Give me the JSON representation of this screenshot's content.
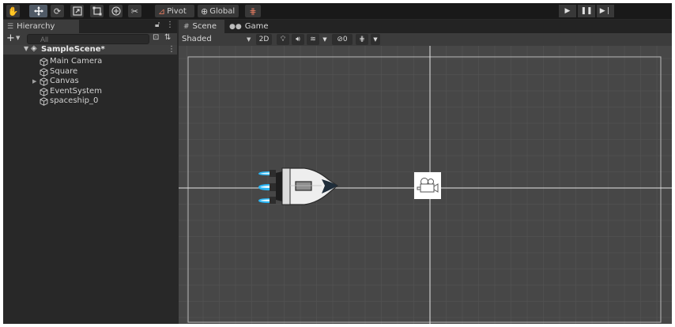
{
  "toolbar": {
    "tools": [
      "hand-tool",
      "move-tool",
      "rotate-tool",
      "scale-tool",
      "rect-tool",
      "transform-tool",
      "custom-tool"
    ],
    "pivot_label": "Pivot",
    "global_label": "Global",
    "playback": [
      "play",
      "pause",
      "step"
    ]
  },
  "hierarchy": {
    "tab_label": "Hierarchy",
    "add_label": "+",
    "search_placeholder": "All",
    "scene_name": "SampleScene*",
    "items": [
      {
        "label": "Main Camera",
        "has_children": false
      },
      {
        "label": "Square",
        "has_children": false
      },
      {
        "label": "Canvas",
        "has_children": true
      },
      {
        "label": "EventSystem",
        "has_children": false
      },
      {
        "label": "spaceship_0",
        "has_children": false
      }
    ]
  },
  "scene_view": {
    "tabs": [
      {
        "label": "Scene",
        "active": true
      },
      {
        "label": "Game",
        "active": false
      }
    ],
    "shading_mode": "Shaded",
    "mode_2d_label": "2D",
    "gizmo_count": "0",
    "colors": {
      "viewport_bg": "#474747",
      "grid_line": "#525252",
      "axis_line": "#e6e6e6",
      "thruster_flame": "#29b6f6"
    }
  }
}
